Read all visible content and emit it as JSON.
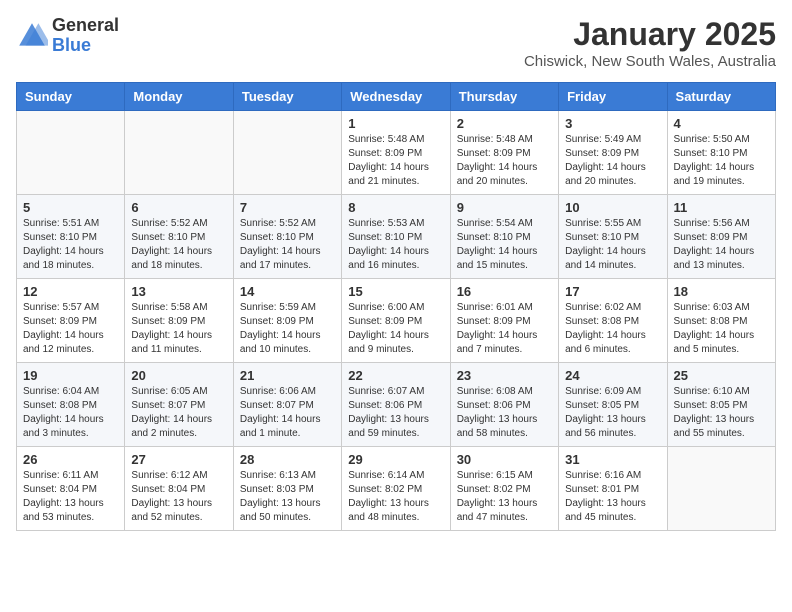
{
  "logo": {
    "general": "General",
    "blue": "Blue"
  },
  "header": {
    "month": "January 2025",
    "location": "Chiswick, New South Wales, Australia"
  },
  "weekdays": [
    "Sunday",
    "Monday",
    "Tuesday",
    "Wednesday",
    "Thursday",
    "Friday",
    "Saturday"
  ],
  "weeks": [
    [
      {
        "day": "",
        "info": ""
      },
      {
        "day": "",
        "info": ""
      },
      {
        "day": "",
        "info": ""
      },
      {
        "day": "1",
        "info": "Sunrise: 5:48 AM\nSunset: 8:09 PM\nDaylight: 14 hours\nand 21 minutes."
      },
      {
        "day": "2",
        "info": "Sunrise: 5:48 AM\nSunset: 8:09 PM\nDaylight: 14 hours\nand 20 minutes."
      },
      {
        "day": "3",
        "info": "Sunrise: 5:49 AM\nSunset: 8:09 PM\nDaylight: 14 hours\nand 20 minutes."
      },
      {
        "day": "4",
        "info": "Sunrise: 5:50 AM\nSunset: 8:10 PM\nDaylight: 14 hours\nand 19 minutes."
      }
    ],
    [
      {
        "day": "5",
        "info": "Sunrise: 5:51 AM\nSunset: 8:10 PM\nDaylight: 14 hours\nand 18 minutes."
      },
      {
        "day": "6",
        "info": "Sunrise: 5:52 AM\nSunset: 8:10 PM\nDaylight: 14 hours\nand 18 minutes."
      },
      {
        "day": "7",
        "info": "Sunrise: 5:52 AM\nSunset: 8:10 PM\nDaylight: 14 hours\nand 17 minutes."
      },
      {
        "day": "8",
        "info": "Sunrise: 5:53 AM\nSunset: 8:10 PM\nDaylight: 14 hours\nand 16 minutes."
      },
      {
        "day": "9",
        "info": "Sunrise: 5:54 AM\nSunset: 8:10 PM\nDaylight: 14 hours\nand 15 minutes."
      },
      {
        "day": "10",
        "info": "Sunrise: 5:55 AM\nSunset: 8:10 PM\nDaylight: 14 hours\nand 14 minutes."
      },
      {
        "day": "11",
        "info": "Sunrise: 5:56 AM\nSunset: 8:09 PM\nDaylight: 14 hours\nand 13 minutes."
      }
    ],
    [
      {
        "day": "12",
        "info": "Sunrise: 5:57 AM\nSunset: 8:09 PM\nDaylight: 14 hours\nand 12 minutes."
      },
      {
        "day": "13",
        "info": "Sunrise: 5:58 AM\nSunset: 8:09 PM\nDaylight: 14 hours\nand 11 minutes."
      },
      {
        "day": "14",
        "info": "Sunrise: 5:59 AM\nSunset: 8:09 PM\nDaylight: 14 hours\nand 10 minutes."
      },
      {
        "day": "15",
        "info": "Sunrise: 6:00 AM\nSunset: 8:09 PM\nDaylight: 14 hours\nand 9 minutes."
      },
      {
        "day": "16",
        "info": "Sunrise: 6:01 AM\nSunset: 8:09 PM\nDaylight: 14 hours\nand 7 minutes."
      },
      {
        "day": "17",
        "info": "Sunrise: 6:02 AM\nSunset: 8:08 PM\nDaylight: 14 hours\nand 6 minutes."
      },
      {
        "day": "18",
        "info": "Sunrise: 6:03 AM\nSunset: 8:08 PM\nDaylight: 14 hours\nand 5 minutes."
      }
    ],
    [
      {
        "day": "19",
        "info": "Sunrise: 6:04 AM\nSunset: 8:08 PM\nDaylight: 14 hours\nand 3 minutes."
      },
      {
        "day": "20",
        "info": "Sunrise: 6:05 AM\nSunset: 8:07 PM\nDaylight: 14 hours\nand 2 minutes."
      },
      {
        "day": "21",
        "info": "Sunrise: 6:06 AM\nSunset: 8:07 PM\nDaylight: 14 hours\nand 1 minute."
      },
      {
        "day": "22",
        "info": "Sunrise: 6:07 AM\nSunset: 8:06 PM\nDaylight: 13 hours\nand 59 minutes."
      },
      {
        "day": "23",
        "info": "Sunrise: 6:08 AM\nSunset: 8:06 PM\nDaylight: 13 hours\nand 58 minutes."
      },
      {
        "day": "24",
        "info": "Sunrise: 6:09 AM\nSunset: 8:05 PM\nDaylight: 13 hours\nand 56 minutes."
      },
      {
        "day": "25",
        "info": "Sunrise: 6:10 AM\nSunset: 8:05 PM\nDaylight: 13 hours\nand 55 minutes."
      }
    ],
    [
      {
        "day": "26",
        "info": "Sunrise: 6:11 AM\nSunset: 8:04 PM\nDaylight: 13 hours\nand 53 minutes."
      },
      {
        "day": "27",
        "info": "Sunrise: 6:12 AM\nSunset: 8:04 PM\nDaylight: 13 hours\nand 52 minutes."
      },
      {
        "day": "28",
        "info": "Sunrise: 6:13 AM\nSunset: 8:03 PM\nDaylight: 13 hours\nand 50 minutes."
      },
      {
        "day": "29",
        "info": "Sunrise: 6:14 AM\nSunset: 8:02 PM\nDaylight: 13 hours\nand 48 minutes."
      },
      {
        "day": "30",
        "info": "Sunrise: 6:15 AM\nSunset: 8:02 PM\nDaylight: 13 hours\nand 47 minutes."
      },
      {
        "day": "31",
        "info": "Sunrise: 6:16 AM\nSunset: 8:01 PM\nDaylight: 13 hours\nand 45 minutes."
      },
      {
        "day": "",
        "info": ""
      }
    ]
  ]
}
